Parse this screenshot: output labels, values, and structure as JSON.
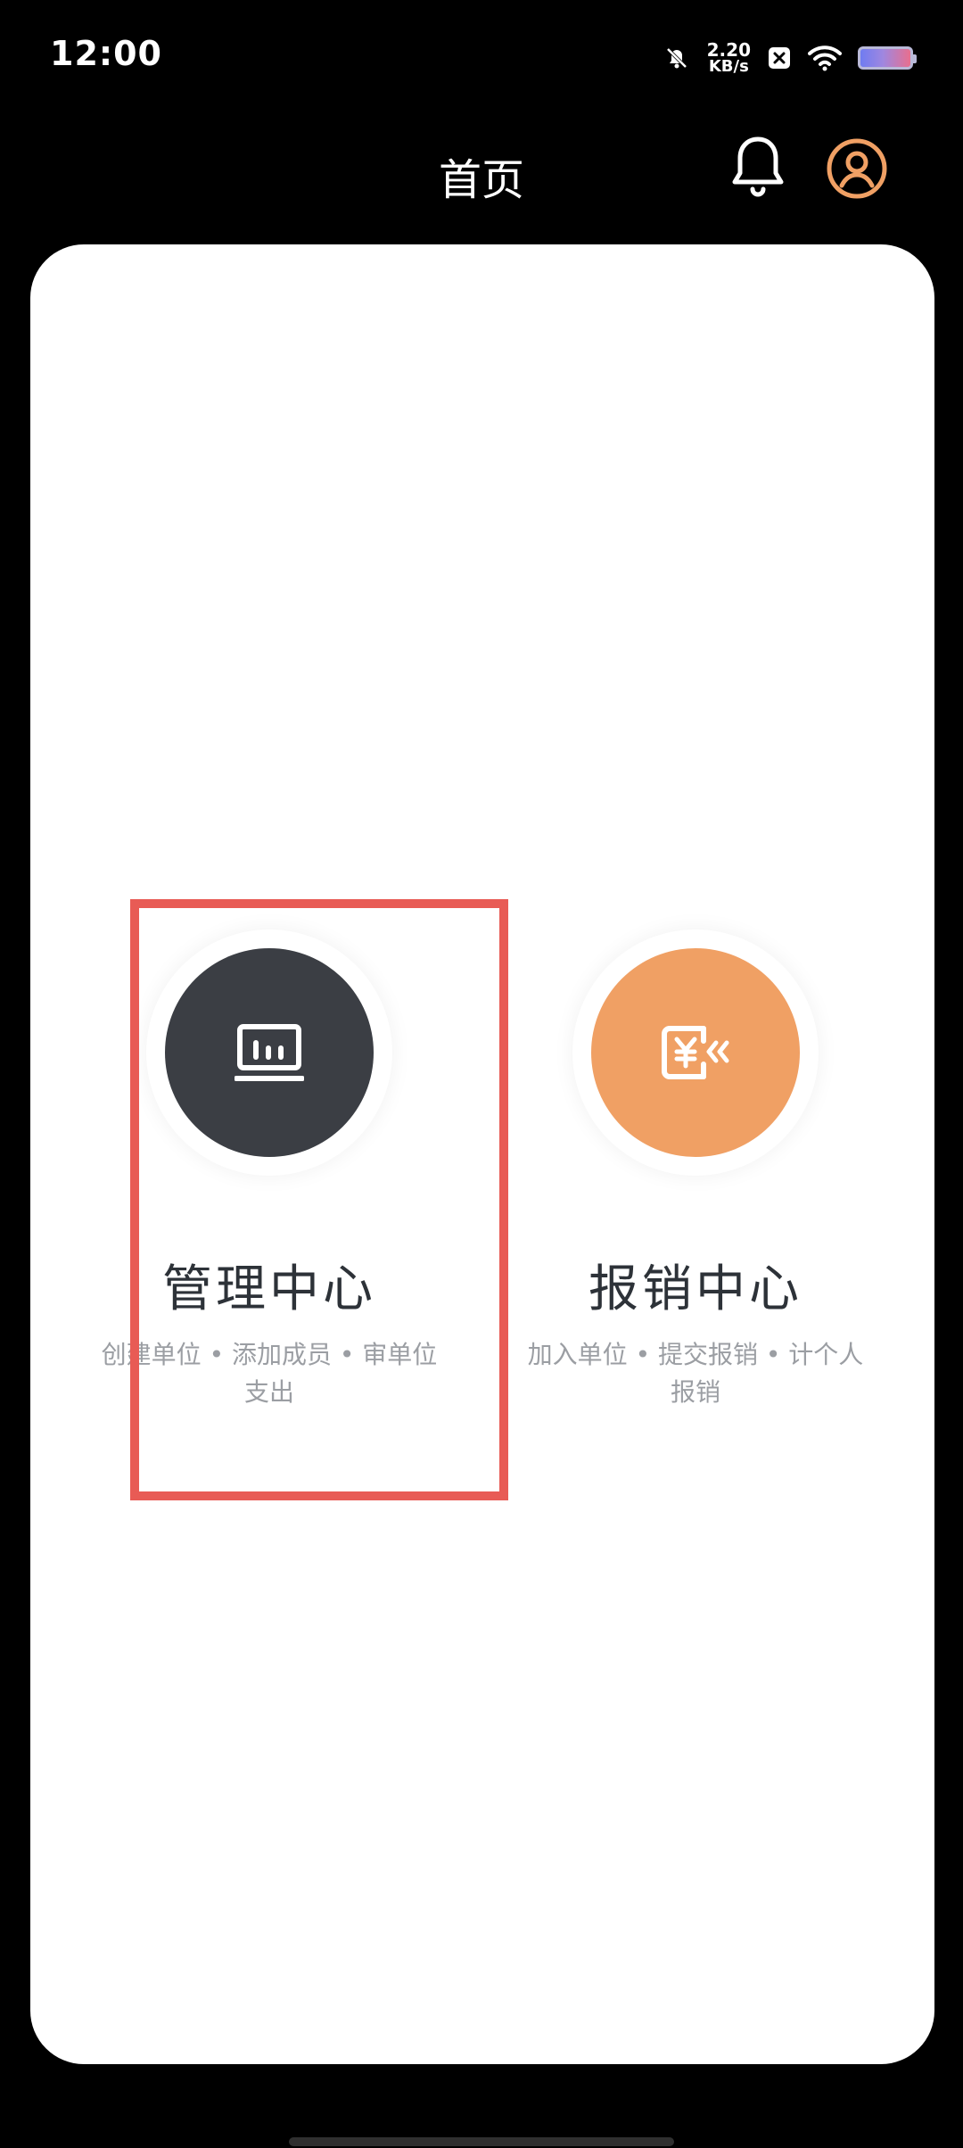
{
  "status_bar": {
    "time": "12:00",
    "net_speed_value": "2.20",
    "net_speed_unit": "KB/s",
    "icons": [
      "mute-bell-icon",
      "close-box-icon",
      "wifi-icon",
      "battery-icon"
    ]
  },
  "header": {
    "title": "首页",
    "right_icons": [
      "bell-icon",
      "profile-icon"
    ]
  },
  "tiles": [
    {
      "title": "管理中心",
      "description": "创建单位 • 添加成员 • 审单位支出",
      "icon": "monitor-chart-icon",
      "color": "#3b3e44"
    },
    {
      "title": "报销中心",
      "description": "加入单位 • 提交报销 • 计个人报销",
      "icon": "yuan-document-icon",
      "color": "#f0a064"
    }
  ],
  "colors": {
    "background": "#000000",
    "card": "#ffffff",
    "accent_orange": "#f0a064",
    "dark_circle": "#3b3e44",
    "highlight": "#e85b55"
  }
}
